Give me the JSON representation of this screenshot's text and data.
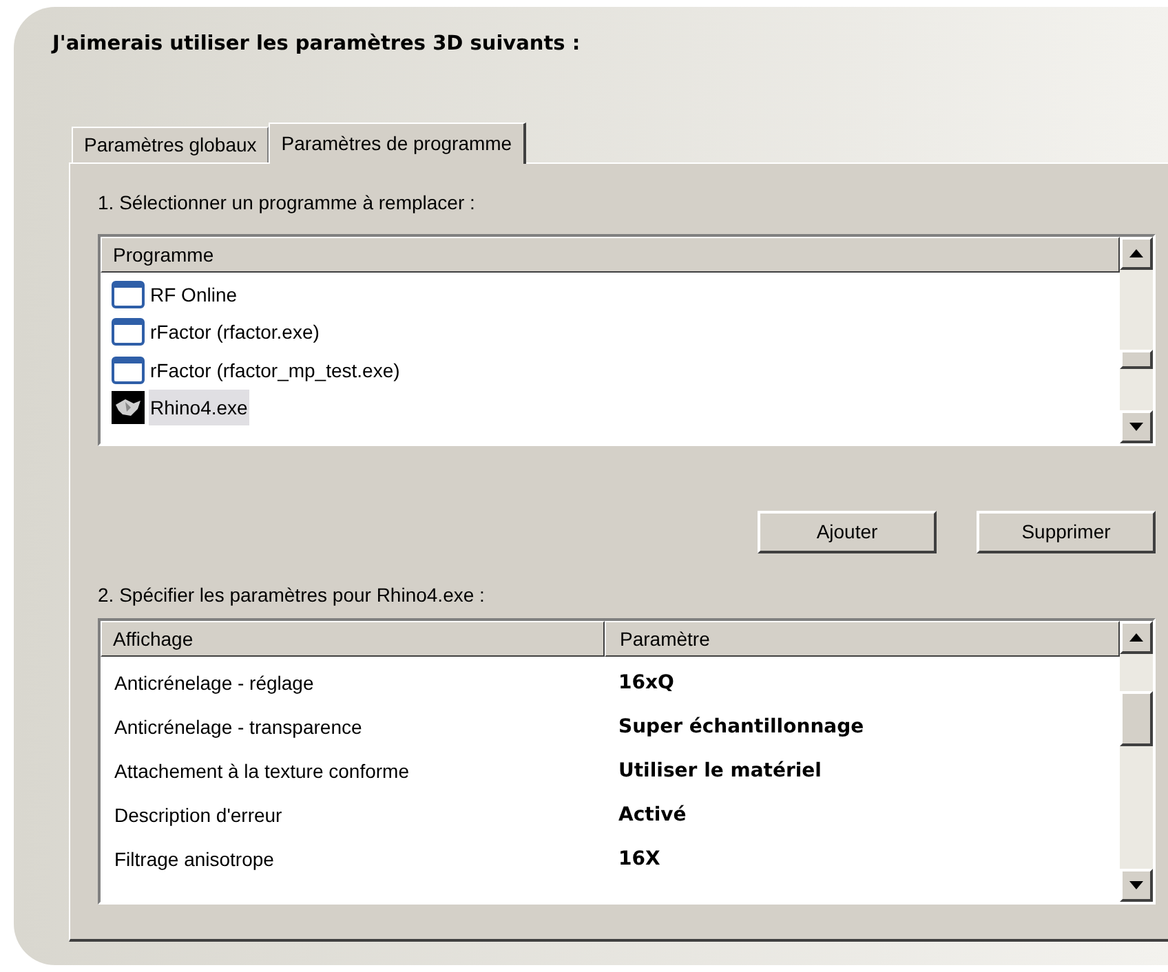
{
  "title": "J'aimerais utiliser les paramètres 3D suivants :",
  "tabs": [
    {
      "label": "Paramètres globaux",
      "selected": false
    },
    {
      "label": "Paramètres de programme",
      "selected": true
    }
  ],
  "program_section": {
    "label": "1. Sélectionner un programme à remplacer :",
    "column": "Programme",
    "rows": [
      {
        "name": "RF Online",
        "kind": "window",
        "selected": false
      },
      {
        "name": "rFactor (rfactor.exe)",
        "kind": "window",
        "selected": false
      },
      {
        "name": "rFactor (rfactor_mp_test.exe)",
        "kind": "window",
        "selected": false
      },
      {
        "name": "Rhino4.exe",
        "kind": "image",
        "selected": true
      }
    ]
  },
  "buttons": [
    "Ajouter",
    "Supprimer"
  ],
  "settings_section": {
    "label": "2. Spécifier les paramètres pour Rhino4.exe :",
    "columns": [
      "Affichage",
      "Paramètre"
    ],
    "rows": [
      {
        "feature": "Anticrénelage - réglage",
        "value": "16xQ"
      },
      {
        "feature": "Anticrénelage - transparence",
        "value": "Super échantillonnage"
      },
      {
        "feature": "Attachement à la texture conforme",
        "value": "Utiliser le matériel"
      },
      {
        "feature": "Description d'erreur",
        "value": "Activé"
      },
      {
        "feature": "Filtrage anisotrope",
        "value": "16X"
      }
    ]
  }
}
